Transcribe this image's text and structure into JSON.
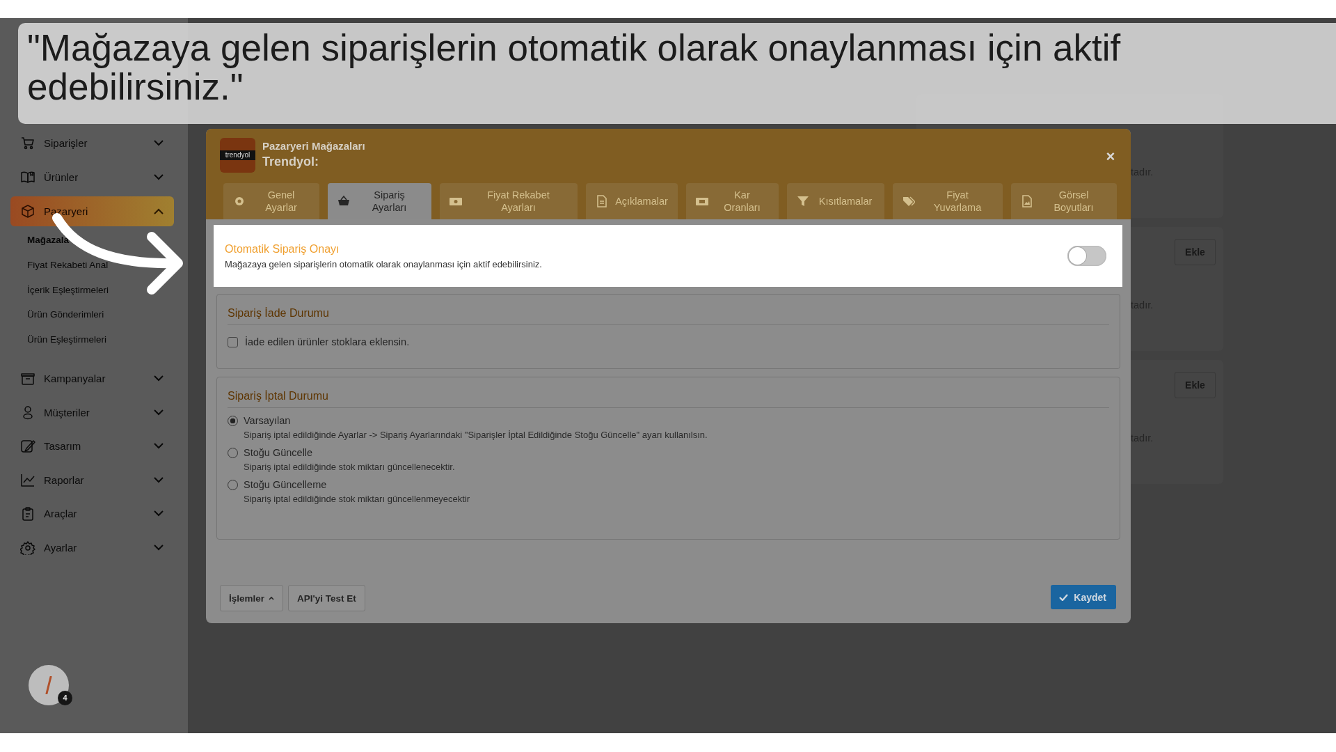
{
  "caption": "\"Mağazaya gelen siparişlerin otomatik olarak onaylanması için aktif edebilirsiniz.\"",
  "sidebar": {
    "items": [
      {
        "label": "Siparişler",
        "selected": false,
        "expanded": false
      },
      {
        "label": "Ürünler",
        "selected": false,
        "expanded": false
      },
      {
        "label": "Pazaryeri",
        "selected": true,
        "expanded": true,
        "children": [
          {
            "label": "Mağazala",
            "selected": true
          },
          {
            "label": "Fiyat Rekabeti Anal",
            "selected": false
          },
          {
            "label": "İçerik Eşleştirmeleri",
            "selected": false
          },
          {
            "label": "Ürün Gönderimleri",
            "selected": false
          },
          {
            "label": "Ürün Eşleştirmeleri",
            "selected": false
          }
        ]
      },
      {
        "label": "Kampanyalar",
        "selected": false,
        "expanded": false
      },
      {
        "label": "Müşteriler",
        "selected": false,
        "expanded": false
      },
      {
        "label": "Tasarım",
        "selected": false,
        "expanded": false
      },
      {
        "label": "Raporlar",
        "selected": false,
        "expanded": false
      },
      {
        "label": "Araçlar",
        "selected": false,
        "expanded": false
      },
      {
        "label": "Ayarlar",
        "selected": false,
        "expanded": false
      }
    ]
  },
  "store_cards": [
    {
      "note": "tadır."
    },
    {
      "action": "Ekle",
      "note": "tadır."
    },
    {
      "action": "Ekle",
      "note": "tadır."
    }
  ],
  "modal": {
    "subtitle": "Pazaryeri Mağazaları",
    "title": "Trendyol:",
    "logo": "trendyol",
    "close": "×",
    "tabs": [
      {
        "label": "Genel Ayarlar",
        "selected": false
      },
      {
        "label": "Sipariş Ayarları",
        "selected": true
      },
      {
        "label": "Fiyat Rekabet Ayarları",
        "selected": false
      },
      {
        "label": "Açıklamalar",
        "selected": false
      },
      {
        "label": "Kar Oranları",
        "selected": false
      },
      {
        "label": "Kısıtlamalar",
        "selected": false
      },
      {
        "label": "Fiyat Yuvarlama",
        "selected": false
      },
      {
        "label": "Görsel Boyutları",
        "selected": false
      }
    ],
    "auto_approval": {
      "title": "Otomatik Sipariş Onayı",
      "description": "Mağazaya gelen siparişlerin otomatik olarak onaylanması için aktif edebilirsiniz.",
      "on": false
    },
    "return_section": {
      "title": "Sipariş İade Durumu",
      "option": {
        "label": "İade edilen ürünler stoklara eklensin.",
        "checked": false
      }
    },
    "cancel_section": {
      "title": "Sipariş İptal Durumu",
      "options": [
        {
          "label": "Varsayılan",
          "description": "Sipariş iptal edildiğinde Ayarlar -> Sipariş Ayarlarındaki \"Siparişler İptal Edildiğinde Stoğu Güncelle\" ayarı kullanılsın.",
          "selected": true
        },
        {
          "label": "Stoğu Güncelle",
          "description": "Sipariş iptal edildiğinde stok miktarı güncellenecektir.",
          "selected": false
        },
        {
          "label": "Stoğu Güncelleme",
          "description": "Sipariş iptal edildiğinde stok miktarı güncellenmeyecektir",
          "selected": false
        }
      ]
    },
    "footer_buttons": [
      {
        "label": "İşlemler",
        "kind": "menu"
      },
      {
        "label": "API'yi Test Et",
        "kind": "plain"
      }
    ],
    "save_button": "Kaydet"
  },
  "assistant": {
    "badge": "4"
  }
}
